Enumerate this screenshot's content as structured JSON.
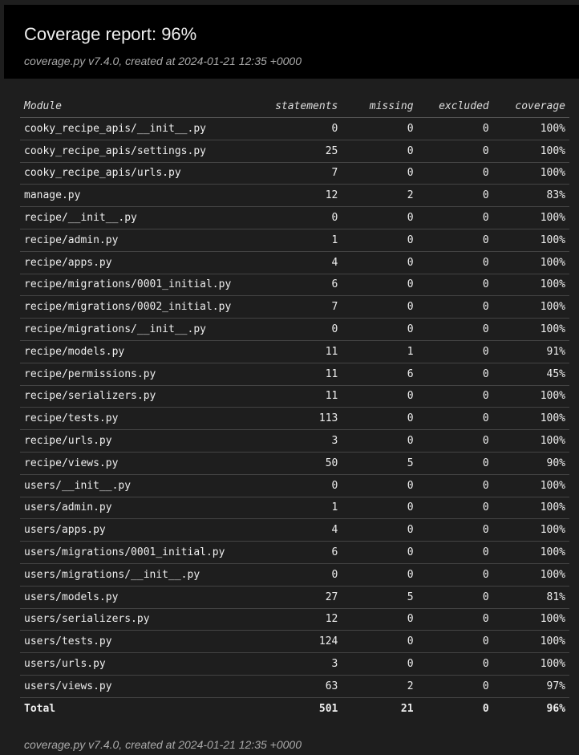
{
  "header": {
    "title": "Coverage report: 96%",
    "subtitle": "coverage.py v7.4.0, created at 2024-01-21 12:35 +0000"
  },
  "table": {
    "columns": [
      "Module",
      "statements",
      "missing",
      "excluded",
      "coverage"
    ],
    "rows": [
      {
        "module": "cooky_recipe_apis/__init__.py",
        "statements": "0",
        "missing": "0",
        "excluded": "0",
        "coverage": "100%"
      },
      {
        "module": "cooky_recipe_apis/settings.py",
        "statements": "25",
        "missing": "0",
        "excluded": "0",
        "coverage": "100%"
      },
      {
        "module": "cooky_recipe_apis/urls.py",
        "statements": "7",
        "missing": "0",
        "excluded": "0",
        "coverage": "100%"
      },
      {
        "module": "manage.py",
        "statements": "12",
        "missing": "2",
        "excluded": "0",
        "coverage": "83%"
      },
      {
        "module": "recipe/__init__.py",
        "statements": "0",
        "missing": "0",
        "excluded": "0",
        "coverage": "100%"
      },
      {
        "module": "recipe/admin.py",
        "statements": "1",
        "missing": "0",
        "excluded": "0",
        "coverage": "100%"
      },
      {
        "module": "recipe/apps.py",
        "statements": "4",
        "missing": "0",
        "excluded": "0",
        "coverage": "100%"
      },
      {
        "module": "recipe/migrations/0001_initial.py",
        "statements": "6",
        "missing": "0",
        "excluded": "0",
        "coverage": "100%"
      },
      {
        "module": "recipe/migrations/0002_initial.py",
        "statements": "7",
        "missing": "0",
        "excluded": "0",
        "coverage": "100%"
      },
      {
        "module": "recipe/migrations/__init__.py",
        "statements": "0",
        "missing": "0",
        "excluded": "0",
        "coverage": "100%"
      },
      {
        "module": "recipe/models.py",
        "statements": "11",
        "missing": "1",
        "excluded": "0",
        "coverage": "91%"
      },
      {
        "module": "recipe/permissions.py",
        "statements": "11",
        "missing": "6",
        "excluded": "0",
        "coverage": "45%"
      },
      {
        "module": "recipe/serializers.py",
        "statements": "11",
        "missing": "0",
        "excluded": "0",
        "coverage": "100%"
      },
      {
        "module": "recipe/tests.py",
        "statements": "113",
        "missing": "0",
        "excluded": "0",
        "coverage": "100%"
      },
      {
        "module": "recipe/urls.py",
        "statements": "3",
        "missing": "0",
        "excluded": "0",
        "coverage": "100%"
      },
      {
        "module": "recipe/views.py",
        "statements": "50",
        "missing": "5",
        "excluded": "0",
        "coverage": "90%"
      },
      {
        "module": "users/__init__.py",
        "statements": "0",
        "missing": "0",
        "excluded": "0",
        "coverage": "100%"
      },
      {
        "module": "users/admin.py",
        "statements": "1",
        "missing": "0",
        "excluded": "0",
        "coverage": "100%"
      },
      {
        "module": "users/apps.py",
        "statements": "4",
        "missing": "0",
        "excluded": "0",
        "coverage": "100%"
      },
      {
        "module": "users/migrations/0001_initial.py",
        "statements": "6",
        "missing": "0",
        "excluded": "0",
        "coverage": "100%"
      },
      {
        "module": "users/migrations/__init__.py",
        "statements": "0",
        "missing": "0",
        "excluded": "0",
        "coverage": "100%"
      },
      {
        "module": "users/models.py",
        "statements": "27",
        "missing": "5",
        "excluded": "0",
        "coverage": "81%"
      },
      {
        "module": "users/serializers.py",
        "statements": "12",
        "missing": "0",
        "excluded": "0",
        "coverage": "100%"
      },
      {
        "module": "users/tests.py",
        "statements": "124",
        "missing": "0",
        "excluded": "0",
        "coverage": "100%"
      },
      {
        "module": "users/urls.py",
        "statements": "3",
        "missing": "0",
        "excluded": "0",
        "coverage": "100%"
      },
      {
        "module": "users/views.py",
        "statements": "63",
        "missing": "2",
        "excluded": "0",
        "coverage": "97%"
      }
    ],
    "total": {
      "module": "Total",
      "statements": "501",
      "missing": "21",
      "excluded": "0",
      "coverage": "96%"
    }
  },
  "footer": {
    "text": "coverage.py v7.4.0, created at 2024-01-21 12:35 +0000"
  },
  "colors": {
    "page_background": "#1e1e1e",
    "header_background": "#000000",
    "text": "#eeeeee",
    "muted_text": "#aaaaaa"
  }
}
